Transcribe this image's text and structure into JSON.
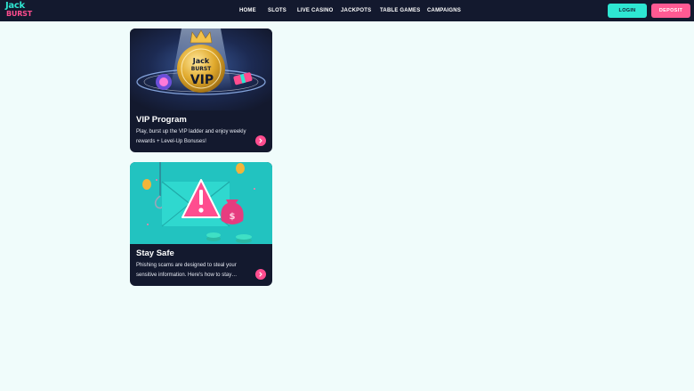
{
  "brand": {
    "logo_line1": "Jack",
    "logo_line2": "BURST"
  },
  "nav": {
    "items": [
      {
        "label": "HOME"
      },
      {
        "label": "SLOTS"
      },
      {
        "label": "LIVE CASINO"
      },
      {
        "label": "JACKPOTS"
      },
      {
        "label": "TABLE GAMES"
      },
      {
        "label": "CAMPAIGNS"
      }
    ]
  },
  "actions": {
    "login_label": "LOGIN",
    "deposit_label": "DEPOSIT"
  },
  "cards": [
    {
      "title": "VIP Program",
      "description": "Play, burst up the VIP ladder and enjoy weekly rewards + Level-Up Bonuses!",
      "image_text_1": "Jack",
      "image_text_2": "BURST",
      "image_text_3": "VIP"
    },
    {
      "title": "Stay Safe",
      "description": "Phishing scams are designed to steal your sensitive information. Here's how to stay…",
      "image_text_1": "$"
    }
  ],
  "colors": {
    "page_background": "#f0fcfb",
    "header_background": "#13192e",
    "accent_teal": "#2ee6d2",
    "accent_pink": "#ff4d8f"
  }
}
